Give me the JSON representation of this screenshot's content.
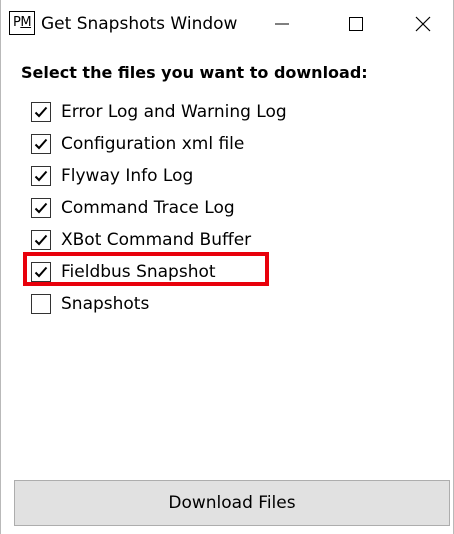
{
  "window": {
    "title": "Get Snapshots Window",
    "icon_letters": [
      "P",
      "M"
    ]
  },
  "content": {
    "heading": "Select the files you want to download:",
    "files": [
      {
        "label": "Error Log and Warning Log",
        "checked": true
      },
      {
        "label": "Configuration xml file",
        "checked": true
      },
      {
        "label": "Flyway Info Log",
        "checked": true
      },
      {
        "label": "Command Trace Log",
        "checked": true
      },
      {
        "label": "XBot Command Buffer",
        "checked": true
      },
      {
        "label": "Fieldbus Snapshot",
        "checked": true,
        "highlighted": true
      },
      {
        "label": "Snapshots",
        "checked": false
      }
    ]
  },
  "footer": {
    "download_label": "Download Files"
  },
  "colors": {
    "highlight": "#e8000b",
    "button_bg": "#e1e1e1",
    "button_border": "#adadad"
  },
  "icons": {
    "minimize": "minimize-icon",
    "maximize": "maximize-icon",
    "close": "close-icon",
    "check": "checkmark-icon"
  }
}
